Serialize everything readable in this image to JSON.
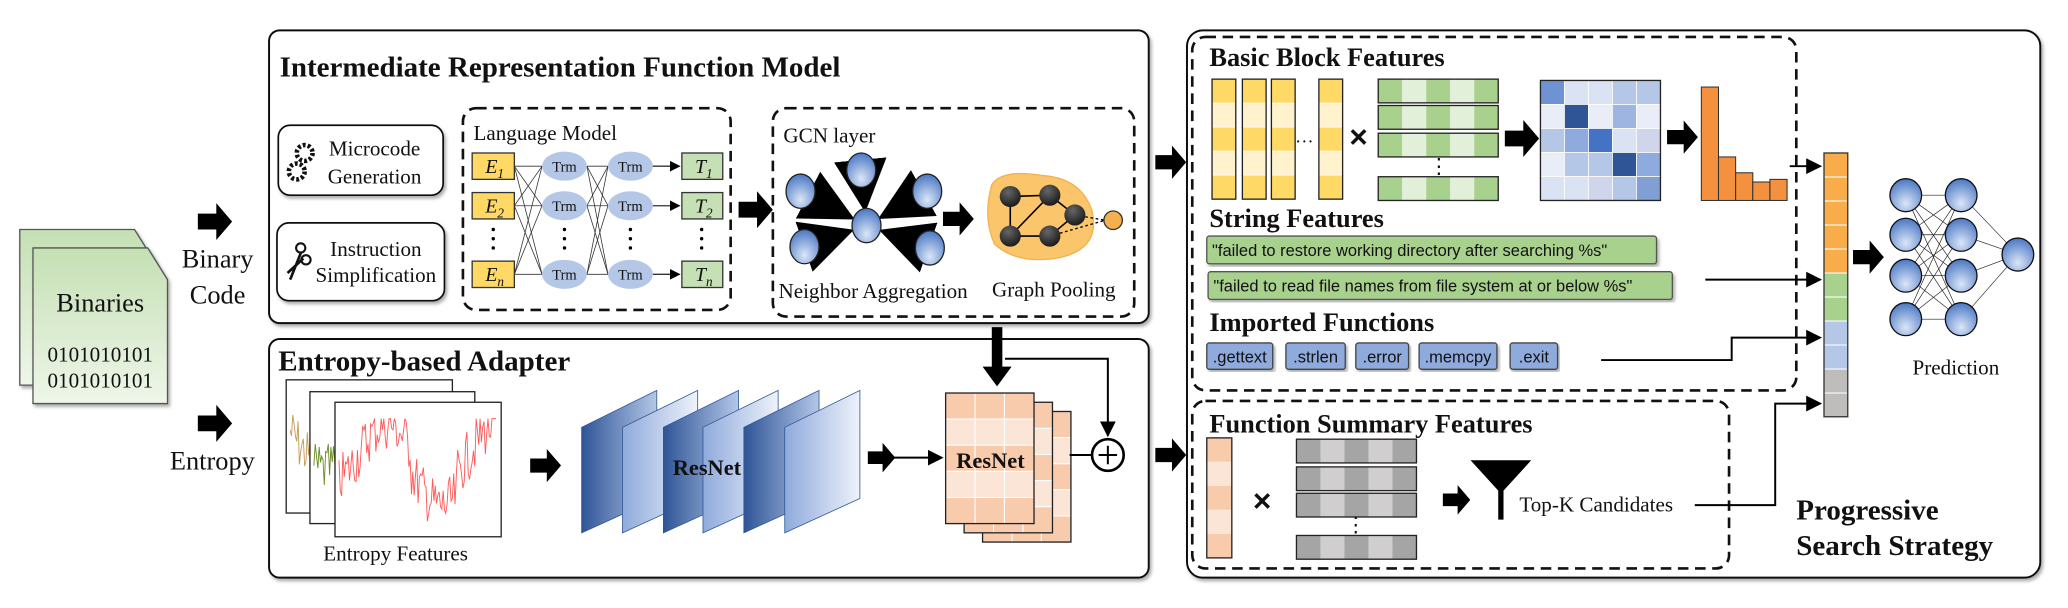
{
  "input": {
    "binaries_label": "Binaries",
    "bits_line1": "0101010101",
    "bits_line2": "0101010101",
    "binary_code_line1": "Binary",
    "binary_code_line2": "Code",
    "entropy_label": "Entropy"
  },
  "ir_model": {
    "title": "Intermediate Representation  Function Model",
    "microcode_line1": "Microcode",
    "microcode_line2": "Generation",
    "instruction_line1": "Instruction",
    "instruction_line2": "Simplification",
    "language_model": {
      "title": "Language Model",
      "inputs": [
        {
          "var": "E",
          "sub": "1"
        },
        {
          "var": "E",
          "sub": "2"
        },
        {
          "var": "E",
          "sub": "n"
        }
      ],
      "outputs": [
        {
          "var": "T",
          "sub": "1"
        },
        {
          "var": "T",
          "sub": "2"
        },
        {
          "var": "T",
          "sub": "n"
        }
      ],
      "block_label": "Trm"
    },
    "gcn": {
      "title": "GCN layer",
      "neighbor_label": "Neighbor Aggregation",
      "pooling_label": "Graph Pooling"
    }
  },
  "entropy_adapter": {
    "title": "Entropy-based Adapter",
    "features_label": "Entropy Features",
    "resnet_label": "ResNet",
    "resnet_output_label": "ResNet"
  },
  "search": {
    "basic_block_title": "Basic Block Features",
    "ellipsis": "…",
    "times": "×",
    "vdots": "⋮",
    "string_title": "String Features",
    "strings": [
      "\"failed to restore working directory after searching %s\"",
      "\"failed to read file names from file system at or below %s\""
    ],
    "imported_title": "Imported Functions",
    "imports": [
      ".gettext",
      ".strlen",
      ".error",
      ".memcpy",
      ".exit"
    ],
    "summary_title": "Function Summary Features",
    "topk_label": "Top-K Candidates",
    "strategy_line1": "Progressive",
    "strategy_line2": "Search Strategy",
    "prediction_label": "Prediction"
  },
  "colors": {
    "yellow": "#ffd966",
    "yellow_light": "#fff2cc",
    "green": "#a9d18e",
    "green_light": "#e2f0d9",
    "blue_node": "#b4c7e7",
    "blue_dark": "#2f5597",
    "orange": "#f4913e",
    "vector_orange": "#f8ad4a",
    "pink": "#f8cbad",
    "pink_light": "#fbe5d6",
    "gray": "#a5a5a5",
    "gray_light": "#d0cece",
    "import_blue": "#8faadc",
    "entropy_red": "#ff5a5a"
  },
  "heatmap": [
    [
      "#6f93d2",
      "#dae3f3",
      "#dae3f3",
      "#b4c7e7",
      "#b4c7e7"
    ],
    [
      "#e8edf7",
      "#2f5597",
      "#e8edf7",
      "#9db5e0",
      "#e8edf7"
    ],
    [
      "#b4c7e7",
      "#8faadc",
      "#4472c4",
      "#dae3f3",
      "#cfd5ea"
    ],
    [
      "#e8edf7",
      "#b4c7e7",
      "#b4c7e7",
      "#2f5597",
      "#8faadc"
    ],
    [
      "#dae3f3",
      "#dae3f3",
      "#cfd5ea",
      "#b4c7e7",
      "#7f9fd5"
    ]
  ],
  "histogram_values": [
    86,
    33,
    21,
    14,
    16
  ],
  "feature_vector": [
    "#f8ad4a",
    "#f8ad4a",
    "#f8ad4a",
    "#f8ad4a",
    "#f8ad4a",
    "#a9d18e",
    "#a9d18e",
    "#b4c7e7",
    "#b4c7e7",
    "#bfbcbc",
    "#bfbcbc"
  ]
}
